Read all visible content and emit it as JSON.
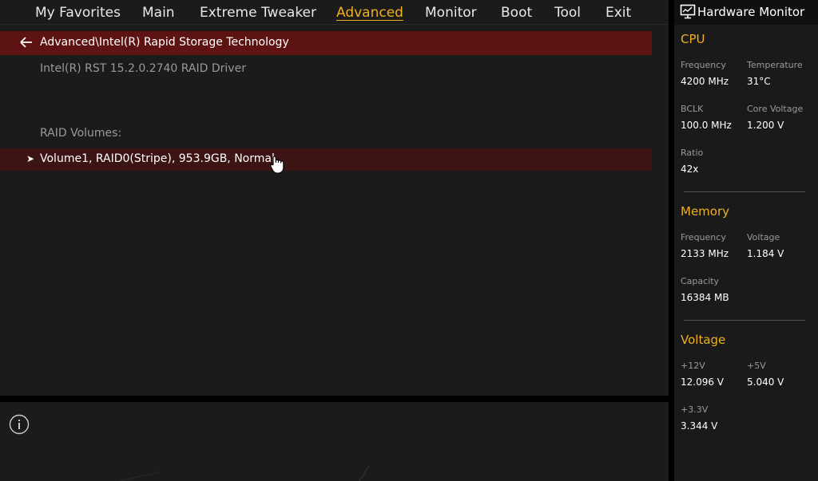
{
  "menu": {
    "tabs": [
      "My Favorites",
      "Main",
      "Extreme Tweaker",
      "Advanced",
      "Monitor",
      "Boot",
      "Tool",
      "Exit"
    ],
    "active": "Advanced"
  },
  "main": {
    "breadcrumb": "Advanced\\Intel(R) Rapid Storage Technology",
    "driver_info": "Intel(R) RST 15.2.0.2740 RAID Driver",
    "section_label": "RAID Volumes:",
    "volume_item": "Volume1, RAID0(Stripe), 953.9GB, Normal"
  },
  "hw": {
    "title": "Hardware Monitor",
    "cpu": {
      "title": "CPU",
      "freq_label": "Frequency",
      "freq_value": "4200 MHz",
      "temp_label": "Temperature",
      "temp_value": "31°C",
      "bclk_label": "BCLK",
      "bclk_value": "100.0 MHz",
      "vcore_label": "Core Voltage",
      "vcore_value": "1.200 V",
      "ratio_label": "Ratio",
      "ratio_value": "42x"
    },
    "memory": {
      "title": "Memory",
      "freq_label": "Frequency",
      "freq_value": "2133 MHz",
      "volt_label": "Voltage",
      "volt_value": "1.184 V",
      "cap_label": "Capacity",
      "cap_value": "16384 MB"
    },
    "voltage": {
      "title": "Voltage",
      "v12_label": "+12V",
      "v12_value": "12.096 V",
      "v5_label": "+5V",
      "v5_value": "5.040 V",
      "v33_label": "+3.3V",
      "v33_value": "3.344 V"
    }
  },
  "colors": {
    "accent": "#f0b020",
    "breadcrumb_bg": "#5e1313",
    "selected_row_bg": "#3d1414",
    "panel_bg": "#1b1b1b"
  },
  "icons": {
    "back": "arrow-left-icon",
    "expand": "chevron-right-icon",
    "info": "info-icon",
    "monitor": "monitor-icon",
    "cursor": "hand-pointer-icon"
  }
}
